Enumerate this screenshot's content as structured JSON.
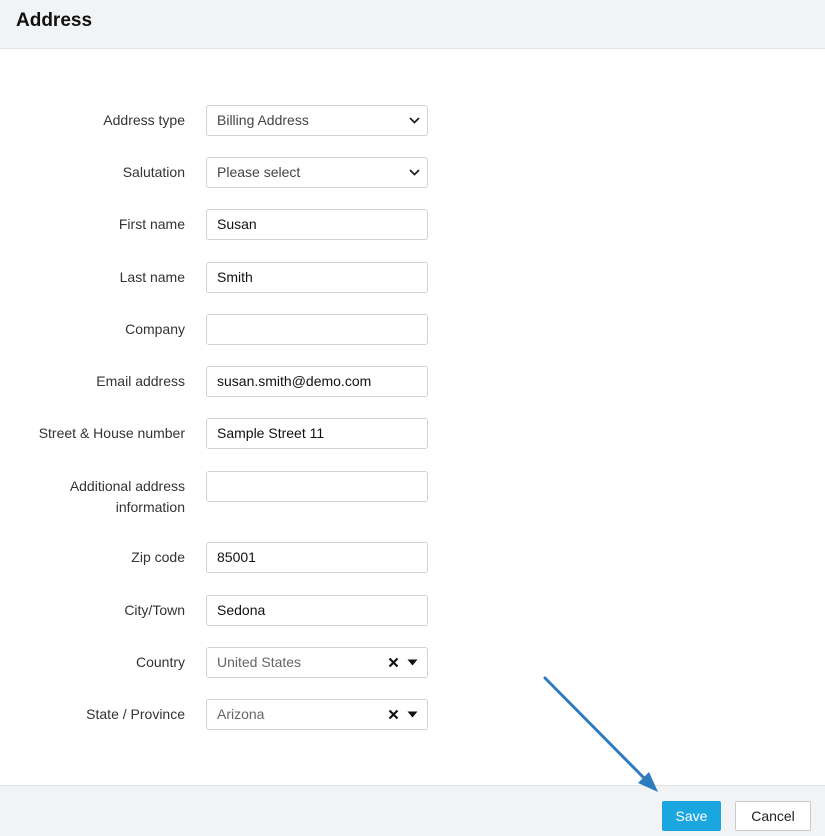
{
  "dialog": {
    "title": "Address"
  },
  "form": {
    "address_type": {
      "label": "Address type",
      "value": "Billing Address"
    },
    "salutation": {
      "label": "Salutation",
      "value": "Please select"
    },
    "first_name": {
      "label": "First name",
      "value": "Susan"
    },
    "last_name": {
      "label": "Last name",
      "value": "Smith"
    },
    "company": {
      "label": "Company",
      "value": ""
    },
    "email": {
      "label": "Email address",
      "value": "susan.smith@demo.com"
    },
    "street": {
      "label": "Street & House number",
      "value": "Sample Street 11"
    },
    "additional": {
      "label_line1": "Additional address",
      "label_line2": "information",
      "value": ""
    },
    "zip": {
      "label": "Zip code",
      "value": "85001"
    },
    "city": {
      "label": "City/Town",
      "value": "Sedona"
    },
    "country": {
      "label": "Country",
      "value": "United States"
    },
    "state": {
      "label": "State / Province",
      "value": "Arizona"
    }
  },
  "footer": {
    "save_label": "Save",
    "cancel_label": "Cancel"
  },
  "colors": {
    "accent": "#1aa7e0",
    "annotation_arrow": "#2f7bbf",
    "header_bg": "#f2f3f5"
  },
  "icons": {
    "select_chevron": "chevron-down-icon",
    "clear": "clear-x-icon",
    "dropdown": "caret-down-icon"
  }
}
